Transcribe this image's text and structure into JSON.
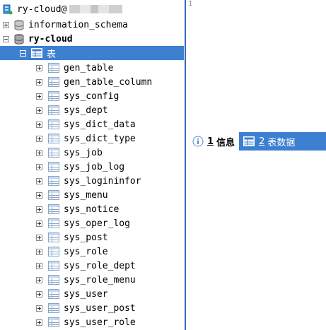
{
  "connection": {
    "name": "ry-cloud@",
    "host_masked": "████"
  },
  "databases": [
    {
      "name": "information_schema",
      "expanded": false
    },
    {
      "name": "ry-cloud",
      "expanded": true
    }
  ],
  "tables_folder": {
    "label": "表",
    "expanded": true
  },
  "tables": [
    "gen_table",
    "gen_table_column",
    "sys_config",
    "sys_dept",
    "sys_dict_data",
    "sys_dict_type",
    "sys_job",
    "sys_job_log",
    "sys_logininfor",
    "sys_menu",
    "sys_notice",
    "sys_oper_log",
    "sys_post",
    "sys_role",
    "sys_role_dept",
    "sys_role_menu",
    "sys_user",
    "sys_user_post",
    "sys_user_role"
  ],
  "tabs": [
    {
      "number": "1",
      "label": "信息",
      "icon": "info-icon",
      "active": true
    },
    {
      "number": "2",
      "label": "表数据",
      "icon": "table-icon",
      "active": false
    }
  ],
  "editor": {
    "cursor_text": "1"
  },
  "colors": {
    "selection": "#3d7fd1",
    "divider": "#2f6db5"
  }
}
